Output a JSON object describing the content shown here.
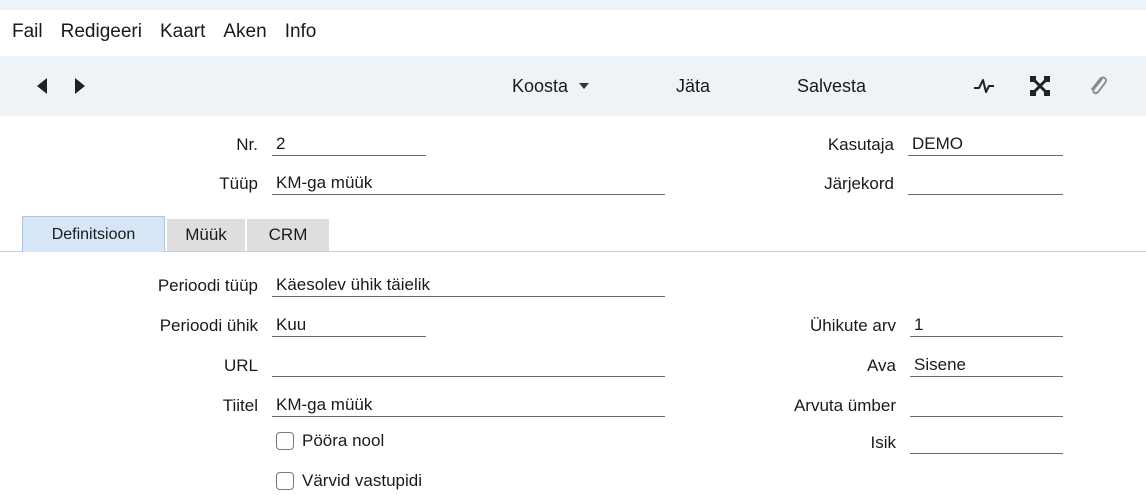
{
  "menu": [
    "Fail",
    "Redigeeri",
    "Kaart",
    "Aken",
    "Info"
  ],
  "toolbar": {
    "koosta_label": "Koosta",
    "jata_label": "Jäta",
    "salvesta_label": "Salvesta"
  },
  "header": {
    "nr_label": "Nr.",
    "nr_value": "2",
    "tuup_label": "Tüüp",
    "tuup_value": "KM-ga müük",
    "kasutaja_label": "Kasutaja",
    "kasutaja_value": "DEMO",
    "jarjekord_label": "Järjekord",
    "jarjekord_value": ""
  },
  "tabs": [
    "Definitsioon",
    "Müük",
    "CRM"
  ],
  "form": {
    "perioodi_tuup_label": "Perioodi tüüp",
    "perioodi_tuup_value": "Käesolev ühik täielik",
    "perioodi_uhik_label": "Perioodi ühik",
    "perioodi_uhik_value": "Kuu",
    "url_label": "URL",
    "url_value": "",
    "tiitel_label": "Tiitel",
    "tiitel_value": "KM-ga müük",
    "uhikute_arv_label": "Ühikute arv",
    "uhikute_arv_value": "1",
    "ava_label": "Ava",
    "ava_value": "Sisene",
    "arvuta_label": "Arvuta ümber",
    "arvuta_value": "",
    "isik_label": "Isik",
    "isik_value": "",
    "poora_nool_label": "Pööra nool",
    "varvid_label": "Värvid vastupidi"
  }
}
